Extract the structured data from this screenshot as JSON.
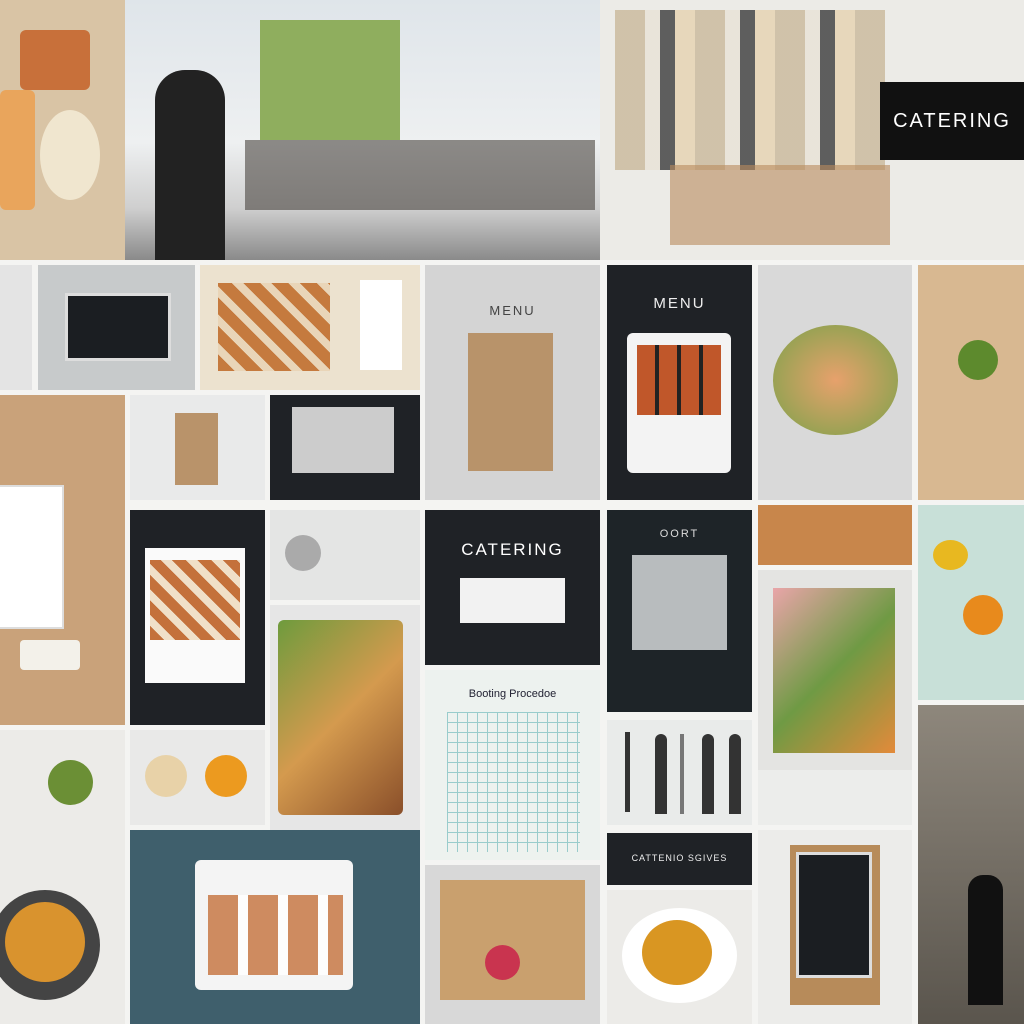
{
  "collage": {
    "monitor_sign": "CATERING",
    "menu_left": "MENU",
    "menu_right": "MENU",
    "catering_panel": "CATERING",
    "oort_panel": "OORT",
    "booking_title": "Booting Procedoe",
    "services_banner": "CATTENIO SGIVES"
  },
  "colors": {
    "dark_panel": "#1f2226",
    "teal_panel": "#3f5f6c",
    "wood": "#c9a27a",
    "light_panel": "#e9eaea"
  }
}
